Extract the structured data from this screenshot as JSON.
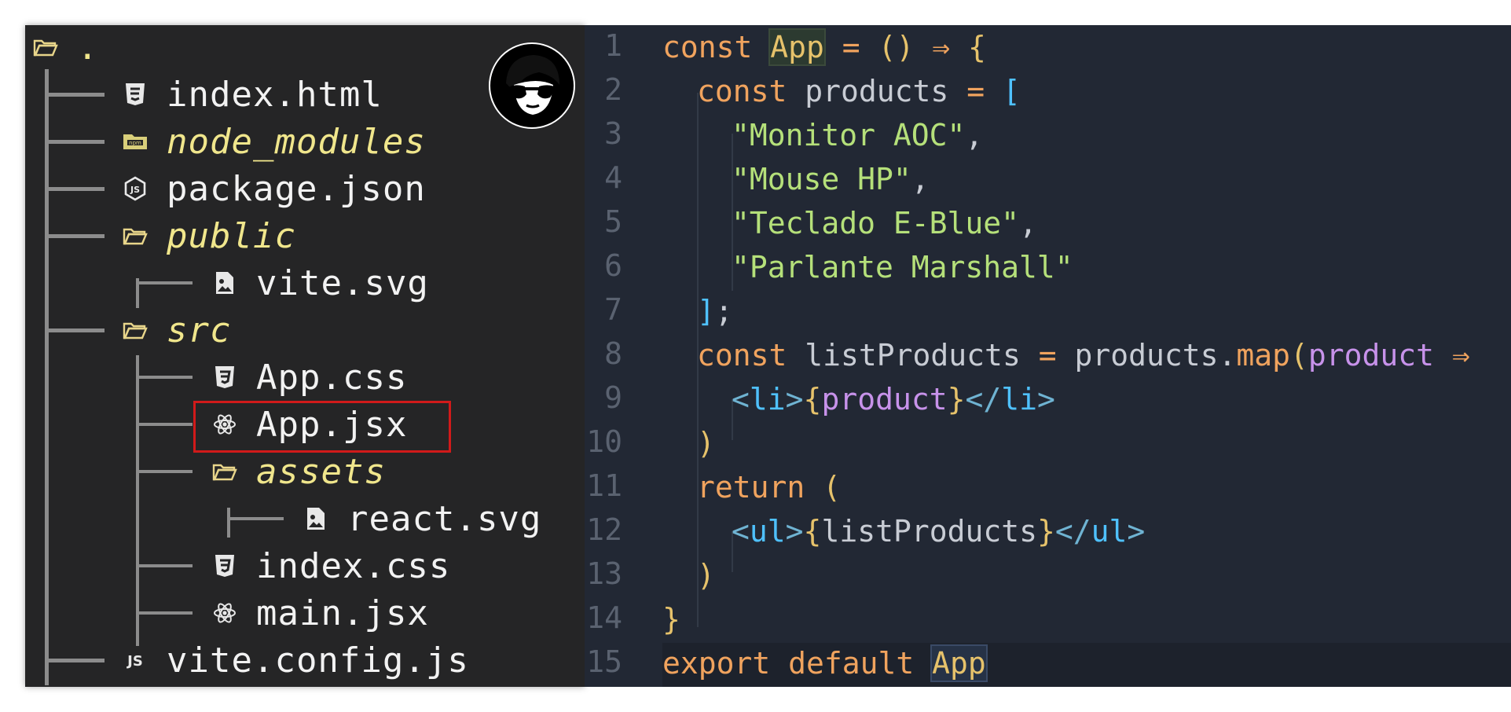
{
  "tree": {
    "root_label": ".",
    "items": [
      {
        "label": "index.html",
        "icon": "html5-icon",
        "type": "file"
      },
      {
        "label": "node_modules",
        "icon": "npm-folder-icon",
        "type": "dir"
      },
      {
        "label": "package.json",
        "icon": "nodejs-icon",
        "type": "file"
      },
      {
        "label": "public",
        "icon": "folder-open-icon",
        "type": "dir"
      },
      {
        "label": "vite.svg",
        "icon": "image-file-icon",
        "type": "file"
      },
      {
        "label": "src",
        "icon": "folder-open-icon",
        "type": "dir"
      },
      {
        "label": "App.css",
        "icon": "css3-icon",
        "type": "file"
      },
      {
        "label": "App.jsx",
        "icon": "react-icon",
        "type": "file"
      },
      {
        "label": "assets",
        "icon": "folder-open-icon",
        "type": "dir"
      },
      {
        "label": "react.svg",
        "icon": "image-file-icon",
        "type": "file"
      },
      {
        "label": "index.css",
        "icon": "css3-icon",
        "type": "file"
      },
      {
        "label": "main.jsx",
        "icon": "react-icon",
        "type": "file"
      },
      {
        "label": "vite.config.js",
        "icon": "js-icon",
        "type": "file"
      }
    ],
    "highlighted": "App.jsx"
  },
  "editor": {
    "line_numbers": [
      "1",
      "2",
      "3",
      "4",
      "5",
      "6",
      "7",
      "8",
      "9",
      "10",
      "11",
      "12",
      "13",
      "14",
      "15"
    ],
    "code": {
      "l1": {
        "a": "const ",
        "b": "App",
        "c": " = ",
        "d": "()",
        "e": " ⇒ ",
        "f": "{"
      },
      "l2": {
        "a": "const ",
        "b": "products",
        "c": " = ",
        "d": "["
      },
      "l3": {
        "a": "\"Monitor AOC\"",
        "b": ","
      },
      "l4": {
        "a": "\"Mouse HP\"",
        "b": ","
      },
      "l5": {
        "a": "\"Teclado E-Blue\"",
        "b": ","
      },
      "l6": {
        "a": "\"Parlante Marshall\""
      },
      "l7": {
        "a": "]",
        "b": ";"
      },
      "l8": {
        "a": "const ",
        "b": "listProducts",
        "c": " = ",
        "d": "products.",
        "e": "map",
        "f": "(",
        "g": "product",
        "h": " ⇒"
      },
      "l9": {
        "a": "<",
        "b": "li",
        "c": ">",
        "d": "{",
        "e": "product",
        "f": "}",
        "g": "</",
        "h": "li",
        "i": ">"
      },
      "l10": {
        "a": ")"
      },
      "l11": {
        "a": "return ",
        "b": "("
      },
      "l12": {
        "a": "<",
        "b": "ul",
        "c": ">",
        "d": "{",
        "e": "listProducts",
        "f": "}",
        "g": "</",
        "h": "ul",
        "i": ">"
      },
      "l13": {
        "a": ")"
      },
      "l14": {
        "a": "}"
      },
      "l15": {
        "a": "export default ",
        "b": "App"
      }
    }
  },
  "colors": {
    "tree_bg": "#252526",
    "editor_bg": "#222834",
    "highlight_border": "#d11a1a",
    "keyword": "#f0a35e",
    "string": "#b5e07a",
    "folder_label": "#f0e68c"
  }
}
